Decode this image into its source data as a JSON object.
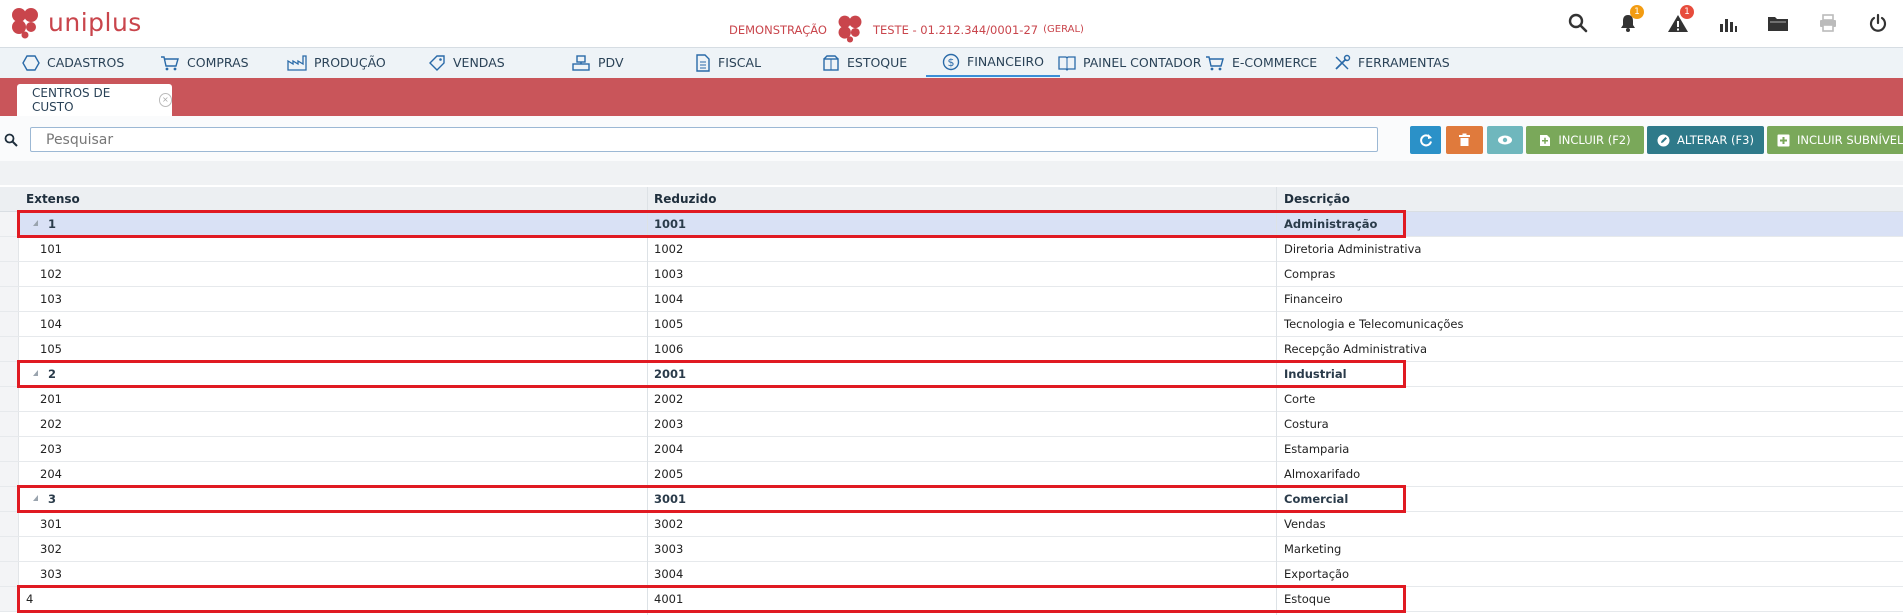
{
  "brand": {
    "name": "uniplus",
    "color": "#c9454c"
  },
  "header": {
    "demo_label": "DEMONSTRAÇÃO",
    "company": "TESTE - 01.212.344/0001-27",
    "scope": "(GERAL)",
    "icons": [
      "search-icon",
      "bell-icon",
      "alert-icon",
      "chart-icon",
      "folder-icon",
      "printer-icon",
      "power-icon"
    ],
    "notifications_count": "1",
    "alerts_count": "1"
  },
  "nav": {
    "items": [
      {
        "label": "CADASTROS",
        "icon": "hexagon-icon"
      },
      {
        "label": "COMPRAS",
        "icon": "cart-icon"
      },
      {
        "label": "PRODUÇÃO",
        "icon": "factory-icon"
      },
      {
        "label": "VENDAS",
        "icon": "tag-icon"
      },
      {
        "label": "PDV",
        "icon": "register-icon"
      },
      {
        "label": "FISCAL",
        "icon": "document-icon"
      },
      {
        "label": "ESTOQUE",
        "icon": "box-icon"
      },
      {
        "label": "FINANCEIRO",
        "icon": "dollar-icon"
      },
      {
        "label": "PAINEL CONTADOR",
        "icon": "book-icon"
      },
      {
        "label": "E-COMMERCE",
        "icon": "cart-icon"
      },
      {
        "label": "FERRAMENTAS",
        "icon": "tools-icon"
      }
    ],
    "active": "FINANCEIRO"
  },
  "tab": {
    "label": "CENTROS DE CUSTO"
  },
  "search": {
    "placeholder": "Pesquisar",
    "value": ""
  },
  "toolbar": {
    "incluir_label": "INCLUIR (F2)",
    "alterar_label": "ALTERAR (F3)",
    "incluir_sub_label": "INCLUIR SUBNÍVEL"
  },
  "grid": {
    "columns": [
      "Extenso",
      "Reduzido",
      "Descrição"
    ],
    "rows": [
      {
        "extenso": "1",
        "reduzido": "1001",
        "descricao": "Administração",
        "group": true,
        "selected": true
      },
      {
        "extenso": "101",
        "reduzido": "1002",
        "descricao": "Diretoria Administrativa"
      },
      {
        "extenso": "102",
        "reduzido": "1003",
        "descricao": "Compras"
      },
      {
        "extenso": "103",
        "reduzido": "1004",
        "descricao": "Financeiro"
      },
      {
        "extenso": "104",
        "reduzido": "1005",
        "descricao": "Tecnologia e Telecomunicações"
      },
      {
        "extenso": "105",
        "reduzido": "1006",
        "descricao": "Recepção Administrativa"
      },
      {
        "extenso": "2",
        "reduzido": "2001",
        "descricao": "Industrial",
        "group": true
      },
      {
        "extenso": "201",
        "reduzido": "2002",
        "descricao": "Corte"
      },
      {
        "extenso": "202",
        "reduzido": "2003",
        "descricao": "Costura"
      },
      {
        "extenso": "203",
        "reduzido": "2004",
        "descricao": "Estamparia"
      },
      {
        "extenso": "204",
        "reduzido": "2005",
        "descricao": "Almoxarifado"
      },
      {
        "extenso": "3",
        "reduzido": "3001",
        "descricao": "Comercial",
        "group": true
      },
      {
        "extenso": "301",
        "reduzido": "3002",
        "descricao": "Vendas"
      },
      {
        "extenso": "302",
        "reduzido": "3003",
        "descricao": "Marketing"
      },
      {
        "extenso": "303",
        "reduzido": "3004",
        "descricao": "Exportação"
      },
      {
        "extenso": "4",
        "reduzido": "4001",
        "descricao": "Estoque",
        "leaf_root": true
      }
    ]
  },
  "annotation_color": "#e01a22"
}
